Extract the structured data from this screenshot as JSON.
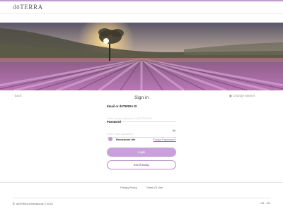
{
  "header": {
    "logo_text": "dōTERRA"
  },
  "nav": {
    "back_label": "Back",
    "change_market_label": "Change Market"
  },
  "signin": {
    "title": "Sign in",
    "email_label": "Email or dōTERRA ID",
    "email_placeholder": "Enter email address or dōTERRA ID",
    "password_label": "Password",
    "password_placeholder": "Enter your password",
    "remember_label": "Remember Me",
    "forgot_label": "Forgot Password?",
    "login_label": "Login",
    "email_today_label": "Enroll today"
  },
  "footer": {
    "links": [
      "Privacy Policy",
      "Terms Of Use"
    ],
    "copyright": "dōTERRA International © 2022",
    "locale": "US - EN"
  },
  "colors": {
    "accent": "#c9a0dc",
    "accent_dark": "#9b5fb6",
    "top_bar": "#c39bd3"
  }
}
